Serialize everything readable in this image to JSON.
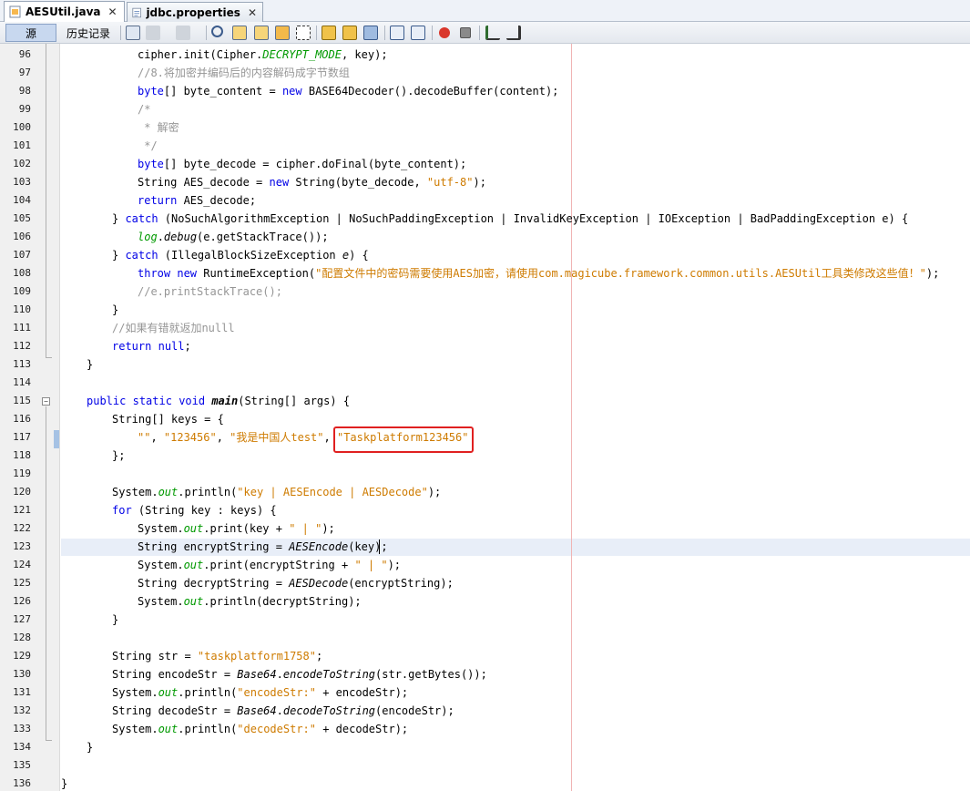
{
  "tabs": [
    {
      "label": "AESUtil.java",
      "active": true
    },
    {
      "label": "jdbc.properties",
      "active": false
    }
  ],
  "toolbar": {
    "source_label": "源",
    "history_label": "历史记录",
    "icons": [
      "last-edit-icon",
      "back-icon",
      "forward-icon",
      "find-icon",
      "find-prev-icon",
      "find-next-icon",
      "toggle-highlight-icon",
      "toggle-selection-icon",
      "prev-bookmark-icon",
      "next-bookmark-icon",
      "toggle-bookmark-icon",
      "shift-left-icon",
      "shift-right-icon",
      "start-macro-icon",
      "stop-macro-icon",
      "comment-icon",
      "uncomment-icon"
    ]
  },
  "editor": {
    "line_numbers": [
      "96",
      "97",
      "98",
      "99",
      "100",
      "101",
      "102",
      "103",
      "104",
      "105",
      "106",
      "107",
      "108",
      "109",
      "110",
      "111",
      "112",
      "113",
      "114",
      "115",
      "116",
      "117",
      "118",
      "119",
      "120",
      "121",
      "122",
      "123",
      "124",
      "125",
      "126",
      "127",
      "128",
      "129",
      "130",
      "131",
      "132",
      "133",
      "134",
      "135",
      "136"
    ],
    "highlighted_string": "\"Taskplatform123456\""
  },
  "code": {
    "l96_a": "cipher.init(Cipher.",
    "l96_b": "DECRYPT_MODE",
    "l96_c": ", key);",
    "l97": "//8.将加密并编码后的内容解码成字节数组",
    "l98_a": "byte",
    "l98_b": "[] byte_content = ",
    "l98_c": "new",
    "l98_d": " BASE64Decoder().decodeBuffer(content);",
    "l99": "/*",
    "l100": " * 解密",
    "l101": " */",
    "l102_a": "byte",
    "l102_b": "[] byte_decode = cipher.doFinal(byte_content);",
    "l103_a": "String AES_decode = ",
    "l103_b": "new",
    "l103_c": " String(byte_decode, ",
    "l103_d": "\"utf-8\"",
    "l103_e": ");",
    "l104_a": "return",
    "l104_b": " AES_decode;",
    "l105_a": "} ",
    "l105_b": "catch",
    "l105_c": " (NoSuchAlgorithmException | NoSuchPaddingException | InvalidKeyException | IOException | BadPaddingException e) {",
    "l106_a": "log",
    "l106_b": ".",
    "l106_c": "debug",
    "l106_d": "(e.getStackTrace());",
    "l107_a": "} ",
    "l107_b": "catch",
    "l107_c": " (IllegalBlockSizeException ",
    "l107_d": "e",
    "l107_e": ") {",
    "l108_a": "throw",
    "l108_b": " ",
    "l108_c": "new",
    "l108_d": " RuntimeException(",
    "l108_e": "\"配置文件中的密码需要使用AES加密，请使用com.magicube.framework.common.utils.AESUtil工具类修改这些值！\"",
    "l108_f": ");",
    "l109": "//e.printStackTrace();",
    "l110": "}",
    "l111": "//如果有错就返加nulll",
    "l112_a": "return",
    "l112_b": " ",
    "l112_c": "null",
    "l112_d": ";",
    "l113": "}",
    "l115_a": "public",
    "l115_b": " ",
    "l115_c": "static",
    "l115_d": " ",
    "l115_e": "void",
    "l115_f": " ",
    "l115_g": "main",
    "l115_h": "(String[] args) {",
    "l116": "String[] keys = {",
    "l117_a": "\"\"",
    "l117_b": ", ",
    "l117_c": "\"123456\"",
    "l117_d": ", ",
    "l117_e": "\"我是中国人test\"",
    "l117_f": ", ",
    "l117_g": "\"Taskplatform123456\"",
    "l118": "};",
    "l120_a": "System.",
    "l120_b": "out",
    "l120_c": ".println(",
    "l120_d": "\"key | AESEncode | AESDecode\"",
    "l120_e": ");",
    "l121_a": "for",
    "l121_b": " (String key : keys) {",
    "l122_a": "System.",
    "l122_b": "out",
    "l122_c": ".print(key + ",
    "l122_d": "\" | \"",
    "l122_e": ");",
    "l123_a": "String encryptString = ",
    "l123_b": "AESEncode",
    "l123_c": "(key);",
    "l124_a": "System.",
    "l124_b": "out",
    "l124_c": ".print(encryptString + ",
    "l124_d": "\" | \"",
    "l124_e": ");",
    "l125_a": "String decryptString = ",
    "l125_b": "AESDecode",
    "l125_c": "(encryptString);",
    "l126_a": "System.",
    "l126_b": "out",
    "l126_c": ".println(decryptString);",
    "l127": "}",
    "l129_a": "String str = ",
    "l129_b": "\"taskplatform1758\"",
    "l129_c": ";",
    "l130_a": "String encodeStr = ",
    "l130_b": "Base64",
    "l130_c": ".",
    "l130_d": "encodeToString",
    "l130_e": "(str.getBytes());",
    "l131_a": "System.",
    "l131_b": "out",
    "l131_c": ".println(",
    "l131_d": "\"encodeStr:\"",
    "l131_e": " + encodeStr);",
    "l132_a": "String decodeStr = ",
    "l132_b": "Base64",
    "l132_c": ".",
    "l132_d": "decodeToString",
    "l132_e": "(encodeStr);",
    "l133_a": "System.",
    "l133_b": "out",
    "l133_c": ".println(",
    "l133_d": "\"decodeStr:\"",
    "l133_e": " + decodeStr);",
    "l134": "}",
    "l136": "}"
  },
  "colors": {
    "keyword": "#0000e6",
    "string": "#ce7b00",
    "comment": "#969696",
    "field": "#009900",
    "highlight_box": "#e02020",
    "current_line": "#e8eef8"
  }
}
